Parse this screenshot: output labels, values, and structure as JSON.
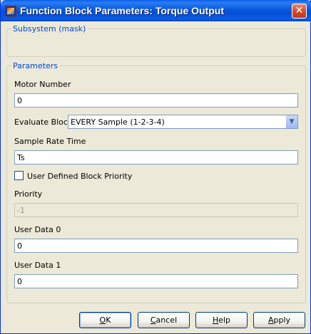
{
  "window": {
    "title": "Function Block Parameters: Torque Output",
    "close_glyph": "✕"
  },
  "mask_group": {
    "legend": "Subsystem (mask)"
  },
  "params": {
    "legend": "Parameters",
    "motor_number": {
      "label": "Motor Number",
      "value": "0"
    },
    "evaluate_block": {
      "label": "Evaluate Block",
      "value": "EVERY Sample (1-2-3-4)",
      "arrow_glyph": "▼"
    },
    "sample_rate": {
      "label": "Sample Rate Time",
      "value": "Ts"
    },
    "user_priority": {
      "label": "User Defined Block Priority",
      "checked": false
    },
    "priority": {
      "label": "Priority",
      "value": "-1"
    },
    "user_data_0": {
      "label": "User Data 0",
      "value": "0"
    },
    "user_data_1": {
      "label": "User Data 1",
      "value": "0"
    }
  },
  "buttons": {
    "ok": {
      "mnemonic": "O",
      "rest": "K"
    },
    "cancel": {
      "mnemonic": "C",
      "rest": "ancel"
    },
    "help": {
      "mnemonic": "H",
      "rest": "elp"
    },
    "apply": {
      "mnemonic": "A",
      "rest": "pply"
    }
  },
  "colors": {
    "title_bar": "#0a58dc",
    "group_legend": "#0046d5",
    "dialog_bg": "#ece9d8"
  }
}
